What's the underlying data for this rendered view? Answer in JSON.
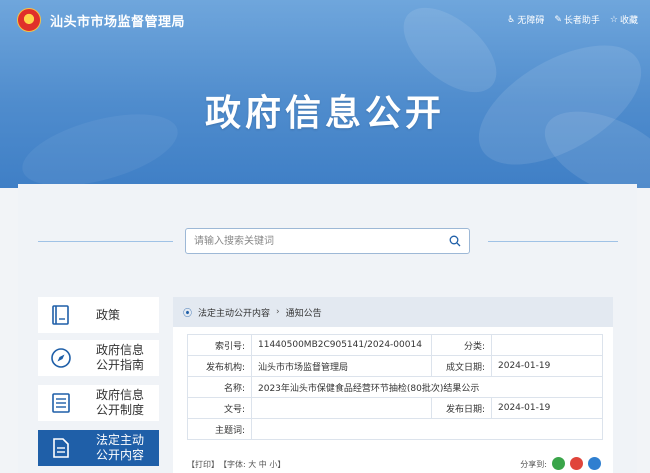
{
  "header": {
    "site_name": "汕头市市场监督管理局",
    "tools": [
      "无障碍",
      "长者助手",
      "收藏"
    ]
  },
  "hero": {
    "title": "政府信息公开"
  },
  "search": {
    "placeholder": "请输入搜索关键词"
  },
  "sidebar": {
    "items": [
      {
        "label_1": "政策",
        "label_2": ""
      },
      {
        "label_1": "政府信息",
        "label_2": "公开指南"
      },
      {
        "label_1": "政府信息",
        "label_2": "公开制度"
      },
      {
        "label_1": "法定主动",
        "label_2": "公开内容"
      }
    ],
    "active_index": 3
  },
  "breadcrumb": [
    "法定主动公开内容",
    "通知公告"
  ],
  "meta": {
    "index_label": "索引号:",
    "index_value": "11440500MB2C905141/2024-00014",
    "category_label": "分类:",
    "category_value": "",
    "org_label": "发布机构:",
    "org_value": "汕头市市场监督管理局",
    "written_label": "成文日期:",
    "written_value": "2024-01-19",
    "name_label": "名称:",
    "name_value": "2023年汕头市保健食品经营环节抽检(80批次)结果公示",
    "doc_label": "文号:",
    "doc_value": "",
    "publish_label": "发布日期:",
    "publish_value": "2024-01-19",
    "keywords_label": "主题词:",
    "keywords_value": ""
  },
  "toolbar": {
    "print": "【打印】",
    "font_label": "【字体:",
    "font_large": "大",
    "font_medium": "中",
    "font_small": "小】",
    "share_label": "分享到:"
  },
  "colors": {
    "accent": "#1f5fa8",
    "hero_top": "#6fa6dc",
    "hero_bottom": "#3f7fc6"
  }
}
